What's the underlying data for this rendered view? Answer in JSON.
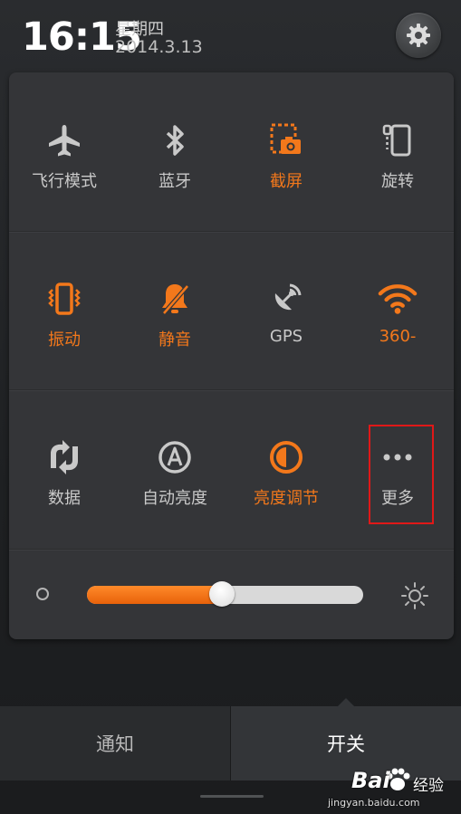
{
  "header": {
    "time": "16:15",
    "weekday": "星期四",
    "date": "2014.3.13",
    "settings_icon": "gear-icon"
  },
  "colors": {
    "accent": "#f3781b",
    "inactive": "#c9c9c9",
    "highlight_box": "#e01818"
  },
  "toggles": [
    {
      "label": "飞行模式",
      "icon": "airplane-icon",
      "active": false
    },
    {
      "label": "蓝牙",
      "icon": "bluetooth-icon",
      "active": false
    },
    {
      "label": "截屏",
      "icon": "screenshot-icon",
      "active": true
    },
    {
      "label": "旋转",
      "icon": "rotate-icon",
      "active": false
    },
    {
      "label": "振动",
      "icon": "vibrate-icon",
      "active": true
    },
    {
      "label": "静音",
      "icon": "mute-icon",
      "active": true
    },
    {
      "label": "GPS",
      "icon": "gps-icon",
      "active": false
    },
    {
      "label": "360-",
      "icon": "wifi-icon",
      "active": true
    },
    {
      "label": "数据",
      "icon": "data-icon",
      "active": false
    },
    {
      "label": "自动亮度",
      "icon": "auto-brightness-icon",
      "active": false
    },
    {
      "label": "亮度调节",
      "icon": "brightness-adjust-icon",
      "active": true
    },
    {
      "label": "更多",
      "icon": "more-icon",
      "active": false
    }
  ],
  "brightness": {
    "level": 0.49,
    "min_icon": "dim-icon",
    "max_icon": "sun-icon"
  },
  "tabs": {
    "notifications": "通知",
    "toggles": "开关",
    "selected": "toggles"
  },
  "watermark": {
    "logo": "Bai",
    "text": "经验",
    "url": "jingyan.baidu.com"
  }
}
